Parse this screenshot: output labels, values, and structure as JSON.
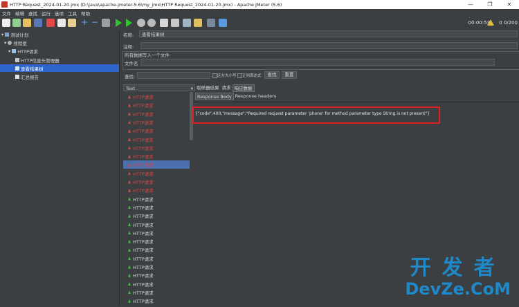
{
  "window": {
    "title": "HTTP Request_2024-01-20.jmx (D:\\java\\apache-jmeter-5.6\\my_jmx\\HTTP Request_2024-01-20.jmx) - Apache JMeter (5.6)",
    "minimize": "—",
    "maximize": "❐",
    "close": "✕"
  },
  "menu": [
    "文件",
    "编辑",
    "查找",
    "运行",
    "选项",
    "工具",
    "帮助"
  ],
  "toolbar": {
    "elapsed": "00:00:53",
    "threads": "0 0/200"
  },
  "tree": {
    "items": [
      {
        "label": "测试计划",
        "prefix": "▾"
      },
      {
        "label": "线程组",
        "prefix": "▾"
      },
      {
        "label": "HTTP请求",
        "prefix": "▾"
      },
      {
        "label": "HTTP信息头管理器",
        "prefix": ""
      },
      {
        "label": "查看结果树",
        "prefix": ""
      },
      {
        "label": "汇总报告",
        "prefix": ""
      }
    ]
  },
  "form": {
    "name_label": "名称:",
    "name_value": "查看结果树",
    "comment_label": "注释:",
    "write_all_label": "所有数据写入一个文件",
    "filename_label": "文件名",
    "search_label": "查找:",
    "case_sensitive": "区分大小写",
    "regex": "正则表达式",
    "find_button": "查找",
    "reset_button": "重置"
  },
  "results": {
    "renderer": "Text",
    "items": [
      {
        "label": "HTTP请求",
        "status": "error"
      },
      {
        "label": "HTTP请求",
        "status": "error"
      },
      {
        "label": "HTTP请求",
        "status": "error"
      },
      {
        "label": "HTTP请求",
        "status": "error"
      },
      {
        "label": "HTTP请求",
        "status": "error"
      },
      {
        "label": "HTTP请求",
        "status": "error"
      },
      {
        "label": "HTTP请求",
        "status": "error"
      },
      {
        "label": "HTTP请求",
        "status": "error"
      },
      {
        "label": "HTTP请求",
        "status": "error",
        "selected": true
      },
      {
        "label": "HTTP请求",
        "status": "error"
      },
      {
        "label": "HTTP请求",
        "status": "error"
      },
      {
        "label": "HTTP请求",
        "status": "error"
      },
      {
        "label": "HTTP请求",
        "status": "ok"
      },
      {
        "label": "HTTP请求",
        "status": "ok"
      },
      {
        "label": "HTTP请求",
        "status": "ok"
      },
      {
        "label": "HTTP请求",
        "status": "ok"
      },
      {
        "label": "HTTP请求",
        "status": "ok"
      },
      {
        "label": "HTTP请求",
        "status": "ok"
      },
      {
        "label": "HTTP请求",
        "status": "ok"
      },
      {
        "label": "HTTP请求",
        "status": "ok"
      },
      {
        "label": "HTTP请求",
        "status": "ok"
      },
      {
        "label": "HTTP请求",
        "status": "ok"
      },
      {
        "label": "HTTP请求",
        "status": "ok"
      },
      {
        "label": "HTTP请求",
        "status": "ok"
      },
      {
        "label": "HTTP请求",
        "status": "ok"
      },
      {
        "label": "HTTP请求",
        "status": "ok"
      }
    ]
  },
  "tabs": {
    "sampler_result": "取样器结果",
    "request": "请求",
    "response_data": "响应数据",
    "response_body": "Response Body",
    "response_headers": "Response headers"
  },
  "response": {
    "body": "{\"code\":400,\"message\":\"Required request parameter 'phone' for method parameter type String is not present\"}"
  },
  "colors": {
    "error": "#d04a4a",
    "ok": "#3fbf3f",
    "selected": "#2f65ca",
    "highlight": "#e02020"
  },
  "watermark": {
    "cn": "开发者",
    "en": "DevZe.CoM"
  }
}
